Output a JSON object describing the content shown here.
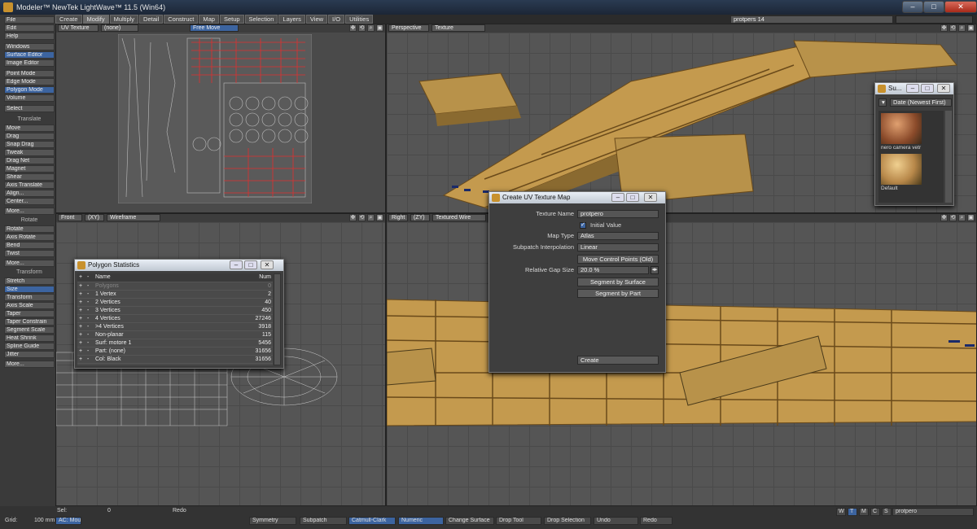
{
  "window": {
    "title": "Modeler™ NewTek LightWave™ 11.5 (Win64)"
  },
  "menu_tabs": [
    "Create",
    "Modify",
    "Multiply",
    "Detail",
    "Construct",
    "Map",
    "Setup",
    "Selection",
    "Layers",
    "View",
    "I/O",
    "Utilities"
  ],
  "layer_field": "protpers 14",
  "left_toolbar": {
    "top_items": [
      "File",
      "Edit",
      "Help",
      "Windows",
      "Surface Editor",
      "Image Editor",
      "Point Mode",
      "Edge Mode",
      "Polygon Mode",
      "Volume",
      "Select"
    ],
    "translate_header": "Translate",
    "translate_items": [
      "Move",
      "Drag",
      "Snap Drag",
      "Tweak",
      "Drag Net",
      "Magnet",
      "Shear",
      "Axis Translate",
      "Align...",
      "Center...",
      "More..."
    ],
    "rotate_header": "Rotate",
    "rotate_items": [
      "Rotate",
      "Axis Rotate",
      "Bend",
      "Twist",
      "More..."
    ],
    "transform_header": "Transform",
    "transform_items": [
      "Stretch",
      "Size",
      "Transform",
      "Axis Scale",
      "Taper",
      "Taper Constrain",
      "Segment Scale",
      "Heat Shrink",
      "Spline Guide",
      "Jitter",
      "More..."
    ]
  },
  "viewports": {
    "top_left": {
      "mode": "UV Texture",
      "map": "(none)",
      "extra": "Free Move"
    },
    "top_right": {
      "view": "Perspective",
      "render": "Texture"
    },
    "bottom_left": {
      "view": "Front",
      "axes": "(XY)",
      "render": "Wireframe"
    },
    "bottom_right": {
      "view": "Right",
      "axes": "(ZY)",
      "render": "Textured Wire"
    }
  },
  "polygon_statistics": {
    "title": "Polygon Statistics",
    "headers": [
      "Name",
      "Num"
    ],
    "rows": [
      {
        "name": "Polygons",
        "num": "0"
      },
      {
        "name": "1 Vertex",
        "num": "2"
      },
      {
        "name": "2 Vertices",
        "num": "40"
      },
      {
        "name": "3 Vertices",
        "num": "450"
      },
      {
        "name": "4 Vertices",
        "num": "27246"
      },
      {
        "name": ">4 Vertices",
        "num": "3918"
      },
      {
        "name": "Non-planar",
        "num": "115"
      },
      {
        "name": "Surf: motore 1",
        "num": "5456"
      },
      {
        "name": "Part: (none)",
        "num": "31656"
      },
      {
        "name": "Col: Black",
        "num": "31656"
      }
    ]
  },
  "create_uv": {
    "title": "Create UV Texture Map",
    "texture_name_label": "Texture Name",
    "texture_name": "protpero",
    "initial_value": "Initial Value",
    "map_type_label": "Map Type",
    "map_type": "Atlas",
    "subpatch_label": "Subpatch Interpolation",
    "subpatch": "Linear",
    "move_cp": "Move Control Points (Old)",
    "gap_label": "Relative Gap Size",
    "gap": "20.0 %",
    "seg_surface": "Segment by Surface",
    "seg_part": "Segment by Part",
    "create": "Create"
  },
  "surface_preset": {
    "title": "Su...",
    "sort": "Date (Newest First)",
    "items": [
      "nero camera vetr",
      "Default"
    ]
  },
  "bottom": {
    "sel_label": "Sel:",
    "sel_value": "0",
    "redo": "Redo",
    "grid_label": "Grid:",
    "grid_value": "100 mm",
    "ac_mouse": "AC: Mouse",
    "buttons": [
      "Symmetry",
      "Subpatch",
      "Catmull-Clark",
      "Numeric",
      "Change Surface",
      "Drop Tool",
      "Drop Selection",
      "Undo",
      "Redo"
    ],
    "wtmcs": [
      "W",
      "T",
      "M",
      "C",
      "S"
    ],
    "layer": "protpero"
  },
  "colors": {
    "accent": "#3c64a0",
    "hull": "#b8924a",
    "uv_wire": "#e03030"
  }
}
